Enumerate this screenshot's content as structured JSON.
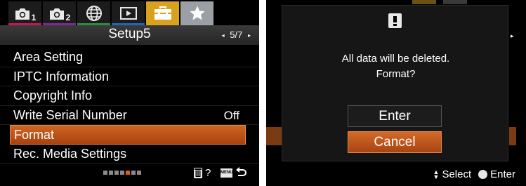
{
  "left": {
    "tabs": [
      {
        "name": "camera1",
        "sub": "1"
      },
      {
        "name": "camera2",
        "sub": "2"
      },
      {
        "name": "network",
        "sub": ""
      },
      {
        "name": "playback",
        "sub": ""
      },
      {
        "name": "setup",
        "sub": ""
      },
      {
        "name": "my-menu",
        "sub": ""
      }
    ],
    "header": {
      "title": "Setup5",
      "page": "5/7"
    },
    "menu": [
      {
        "label": "Area Setting",
        "value": ""
      },
      {
        "label": "IPTC Information",
        "value": ""
      },
      {
        "label": "Copyright Info",
        "value": ""
      },
      {
        "label": "Write Serial Number",
        "value": "Off"
      },
      {
        "label": "Format",
        "value": ""
      },
      {
        "label": "Rec. Media Settings",
        "value": ""
      }
    ],
    "footer": {
      "page_count": 7,
      "current_page": 5,
      "help_mark": "?",
      "menu_badge": "MENU"
    }
  },
  "right": {
    "dialog": {
      "message_line1": "All data will be deleted.",
      "message_line2": "Format?",
      "enter_label": "Enter",
      "cancel_label": "Cancel"
    },
    "guide": {
      "select_label": "Select",
      "enter_label": "Enter"
    }
  },
  "colors": {
    "highlight": "#c05a1c",
    "setup_tab": "#d9a21e",
    "my_menu_tab": "#9aa0a6"
  },
  "icons": [
    "camera-icon",
    "globe-icon",
    "playback-icon",
    "toolbox-icon",
    "star-icon",
    "trash-icon",
    "back-arrow-icon",
    "warning-icon"
  ]
}
